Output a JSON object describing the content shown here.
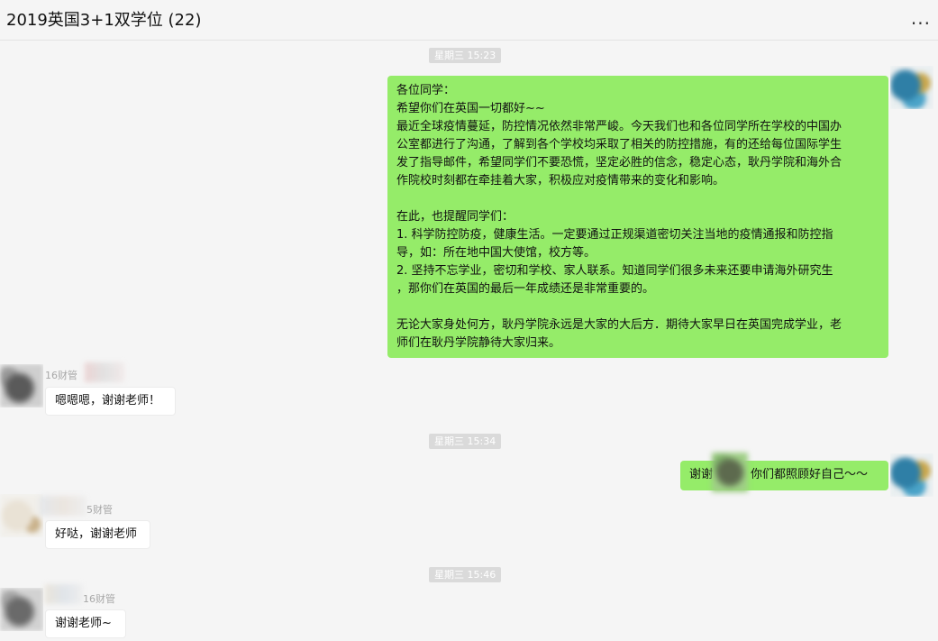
{
  "header": {
    "title": "2019英国3+1双学位 (22)",
    "more_label": "..."
  },
  "timestamps": {
    "t1": "星期三 15:23",
    "t2": "星期三 15:34",
    "t3": "星期三 15:46"
  },
  "messages": {
    "notice": {
      "lines": [
        "各位同学：",
        "希望你们在英国一切都好~~",
        "最近全球疫情蔓延，防控情况依然非常严峻。今天我们也和各位同学所在学校的中国办",
        "公室都进行了沟通，了解到各个学校均采取了相关的防控措施，有的还给每位国际学生",
        "发了指导邮件，希望同学们不要恐慌，坚定必胜的信念，稳定心态，耿丹学院和海外合",
        "作院校时刻都在牵挂着大家，积极应对疫情带来的变化和影响。",
        "",
        "在此，也提醒同学们：",
        "1.    科学防控防疫，健康生活。一定要通过正规渠道密切关注当地的疫情通报和防控指",
        "导，如：所在地中国大使馆，校方等。",
        "2.    坚持不忘学业，密切和学校、家人联系。知道同学们很多未来还要申请海外研究生",
        "，那你们在英国的最后一年成绩还是非常重要的。",
        "",
        "无论大家身处何方，耿丹学院永远是大家的大后方．期待大家早日在英国完成学业，老",
        "师们在耿丹学院静待大家归来。"
      ]
    },
    "reply1": {
      "sender": "16财管",
      "text": "嗯嗯嗯，谢谢老师！"
    },
    "reply2": {
      "text_start": "谢谢",
      "text_end": "你们都照顾好自己～～"
    },
    "reply3": {
      "sender": "5财管",
      "text": "好哒，谢谢老师"
    },
    "reply4": {
      "sender": "16财管",
      "text": "谢谢老师~"
    }
  },
  "colors": {
    "outgoing_bubble": "#95ec69",
    "incoming_bubble": "#ffffff",
    "background": "#f5f5f5",
    "timestamp_bg": "#dadada"
  }
}
